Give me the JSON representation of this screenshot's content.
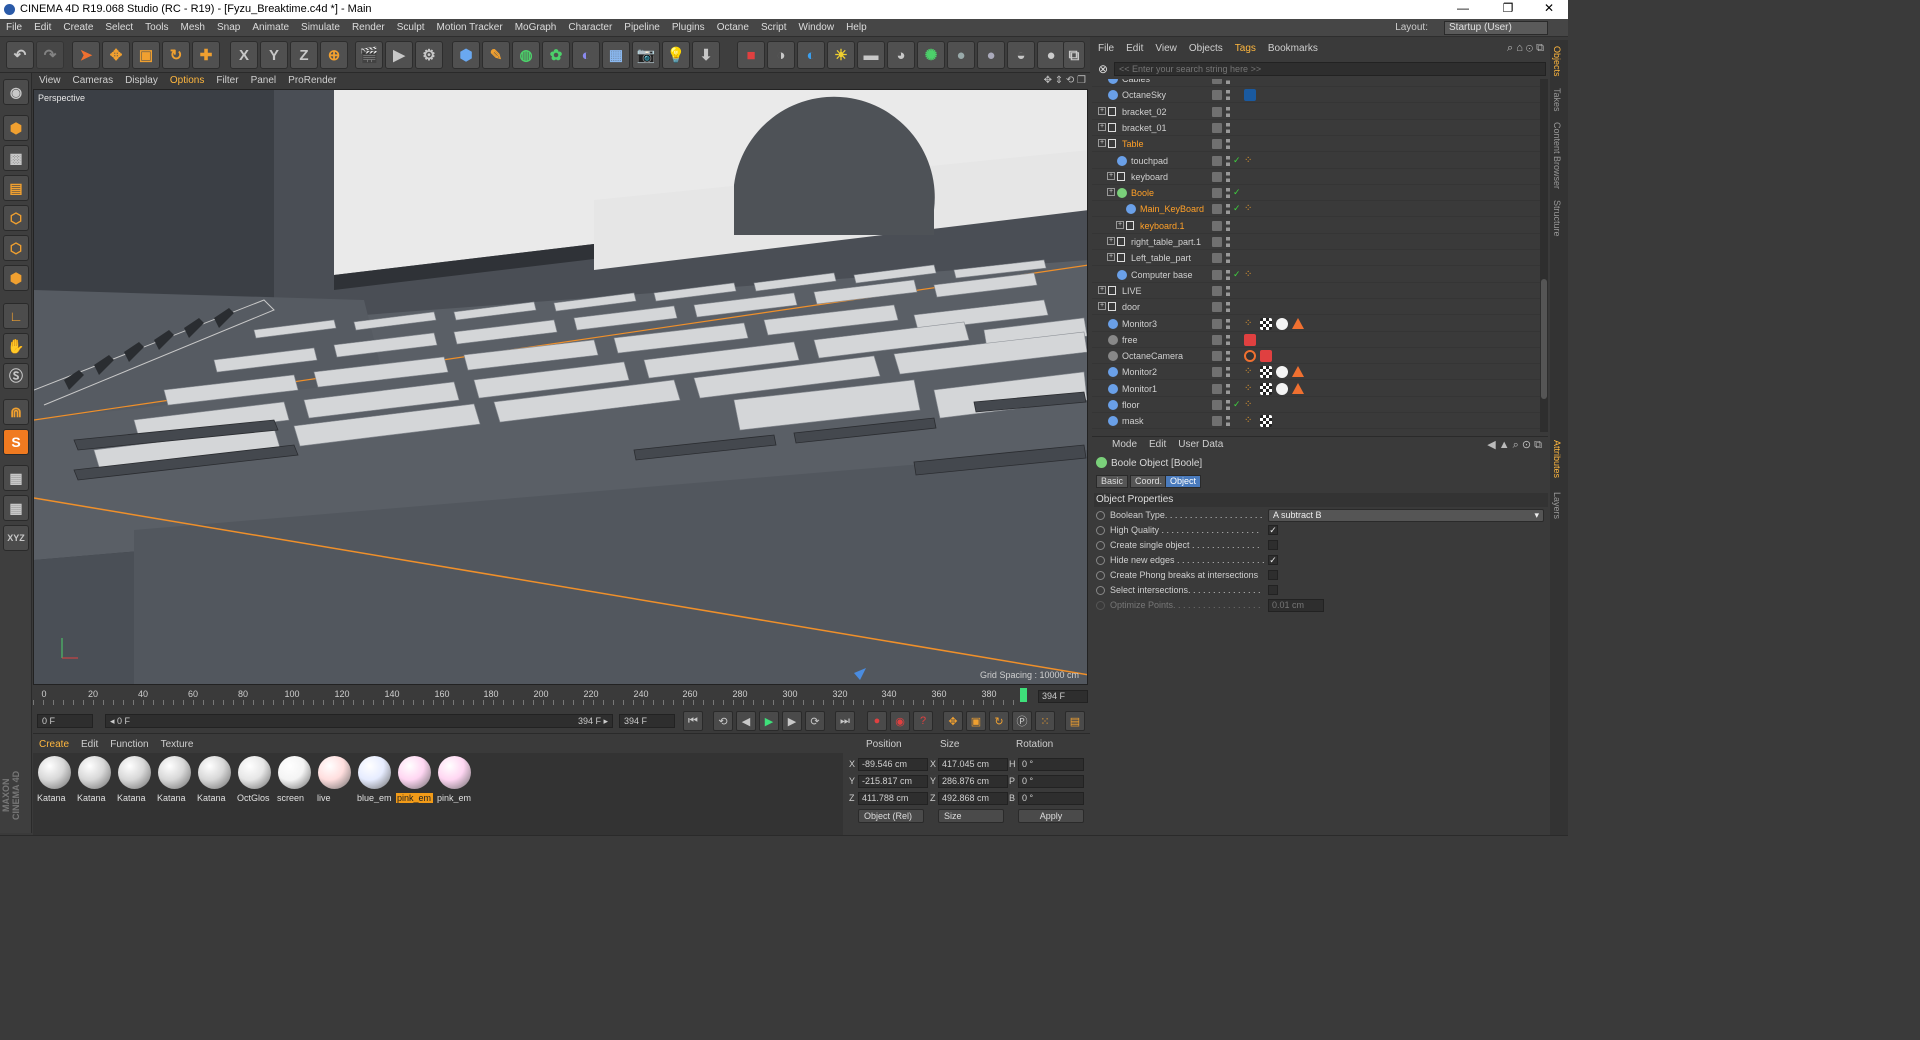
{
  "window": {
    "title": "CINEMA 4D R19.068 Studio (RC - R19) - [Fyzu_Breaktime.c4d *] - Main",
    "controls": [
      "—",
      "❐",
      "✕"
    ]
  },
  "menubar": {
    "items": [
      "File",
      "Edit",
      "Create",
      "Select",
      "Tools",
      "Mesh",
      "Snap",
      "Animate",
      "Simulate",
      "Render",
      "Sculpt",
      "Motion Tracker",
      "MoGraph",
      "Character",
      "Pipeline",
      "Plugins",
      "Octane",
      "Script",
      "Window",
      "Help"
    ],
    "layout_label": "Layout:",
    "layout_value": "Startup (User)"
  },
  "toolbar": {
    "axis_x": "X",
    "axis_y": "Y",
    "axis_z": "Z"
  },
  "viewport": {
    "menu": [
      "View",
      "Cameras",
      "Display",
      "Options",
      "Filter",
      "Panel",
      "ProRender"
    ],
    "active_menu": "Options",
    "label": "Perspective",
    "grid_spacing": "Grid Spacing : 10000 cm"
  },
  "timeline": {
    "ticks": [
      "0",
      "20",
      "40",
      "60",
      "80",
      "100",
      "120",
      "140",
      "160",
      "180",
      "200",
      "220",
      "240",
      "260",
      "280",
      "300",
      "320",
      "340",
      "360",
      "380"
    ],
    "end_frame": "394 F",
    "start_field": "0 F",
    "range_start": "◂ 0 F",
    "range_end": "394 F ▸",
    "max_field": "394 F",
    "current_frame": 394
  },
  "materials": {
    "menu": [
      "Create",
      "Edit",
      "Function",
      "Texture"
    ],
    "active_menu": "Create",
    "items": [
      {
        "name": "Katana",
        "color": "#d8d8d8"
      },
      {
        "name": "Katana",
        "color": "#d8d8d8"
      },
      {
        "name": "Katana",
        "color": "#d8d8d8"
      },
      {
        "name": "Katana",
        "color": "#d8d8d8"
      },
      {
        "name": "Katana",
        "color": "#d8d8d8"
      },
      {
        "name": "OctGlos",
        "color": "#e6e6e6"
      },
      {
        "name": "screen",
        "color": "#f4f4f4"
      },
      {
        "name": "live",
        "color": "#ffdede"
      },
      {
        "name": "blue_em",
        "color": "#e6ecff"
      },
      {
        "name": "pink_em",
        "color": "#ffd6f2",
        "selected": true
      },
      {
        "name": "pink_em",
        "color": "#ffd6f2"
      }
    ]
  },
  "coords": {
    "headers": {
      "position": "Position",
      "size": "Size",
      "rotation": "Rotation"
    },
    "rows": [
      {
        "axis": "X",
        "pos": "-89.546 cm",
        "size_axis": "X",
        "size": "417.045 cm",
        "rot_axis": "H",
        "rot": "0 °"
      },
      {
        "axis": "Y",
        "pos": "-215.817 cm",
        "size_axis": "Y",
        "size": "286.876 cm",
        "rot_axis": "P",
        "rot": "0 °"
      },
      {
        "axis": "Z",
        "pos": "411.788 cm",
        "size_axis": "Z",
        "size": "492.868 cm",
        "rot_axis": "B",
        "rot": "0 °"
      }
    ],
    "mode": "Object (Rel)",
    "size_mode": "Size",
    "apply": "Apply"
  },
  "object_manager": {
    "menu": [
      "File",
      "Edit",
      "View",
      "Objects",
      "Tags",
      "Bookmarks"
    ],
    "active_menu": "Tags",
    "search_placeholder": "<< Enter your search string here >>",
    "rows": [
      {
        "name": "Cables",
        "indent": 0,
        "icon": "#6aa0e8",
        "partial": true
      },
      {
        "name": "OctaneSky",
        "indent": 0,
        "icon": "#6aa0e8",
        "tags": [
          "octane-sky-tag"
        ]
      },
      {
        "name": "bracket_02",
        "indent": 0,
        "icon": "null",
        "expand": true
      },
      {
        "name": "bracket_01",
        "indent": 0,
        "icon": "null",
        "expand": true
      },
      {
        "name": "Table",
        "indent": 0,
        "icon": "null",
        "expand": true,
        "sel": true
      },
      {
        "name": "touchpad",
        "indent": 1,
        "icon": "#6aa0e8",
        "check": true,
        "tags": [
          "phong-tag"
        ]
      },
      {
        "name": "keyboard",
        "indent": 1,
        "icon": "null",
        "expand": true
      },
      {
        "name": "Boole",
        "indent": 1,
        "icon": "#7ad07a",
        "sel": true,
        "expand": true,
        "check": true
      },
      {
        "name": "Main_KeyBoard",
        "indent": 2,
        "icon": "#6aa0e8",
        "sel": true,
        "check": true,
        "tags": [
          "phong-tag"
        ]
      },
      {
        "name": "keyboard.1",
        "indent": 2,
        "icon": "null",
        "sel": true,
        "expand": true
      },
      {
        "name": "right_table_part.1",
        "indent": 1,
        "icon": "null",
        "expand": true
      },
      {
        "name": "Left_table_part",
        "indent": 1,
        "icon": "null",
        "expand": true
      },
      {
        "name": "Computer base",
        "indent": 1,
        "icon": "#6aa0e8",
        "check": true,
        "tags": [
          "phong-tag"
        ]
      },
      {
        "name": "LIVE",
        "indent": 0,
        "icon": "null",
        "expand": true
      },
      {
        "name": "door",
        "indent": 0,
        "icon": "null",
        "expand": true
      },
      {
        "name": "Monitor3",
        "indent": 0,
        "icon": "#6aa0e8",
        "tags": [
          "phong-tag",
          "checker-tag",
          "material-white",
          "warning-tag"
        ]
      },
      {
        "name": "free",
        "indent": 0,
        "icon": "#888",
        "tags": [
          "camera-tag"
        ]
      },
      {
        "name": "OctaneCamera",
        "indent": 0,
        "icon": "#888",
        "tags": [
          "no-tag",
          "camera-tag"
        ]
      },
      {
        "name": "Monitor2",
        "indent": 0,
        "icon": "#6aa0e8",
        "tags": [
          "phong-tag",
          "checker-tag",
          "material-white",
          "warning-tag"
        ]
      },
      {
        "name": "Monitor1",
        "indent": 0,
        "icon": "#6aa0e8",
        "tags": [
          "phong-tag",
          "checker-tag",
          "material-white",
          "warning-tag"
        ]
      },
      {
        "name": "floor",
        "indent": 0,
        "icon": "#6aa0e8",
        "check": true,
        "tags": [
          "phong-tag"
        ]
      },
      {
        "name": "mask",
        "indent": 0,
        "icon": "#6aa0e8",
        "tags": [
          "phong-tag",
          "checker-tag"
        ]
      }
    ]
  },
  "right_tabs": [
    "Objects",
    "Takes",
    "Content Browser",
    "Structure",
    "Attributes",
    "Layers"
  ],
  "attributes": {
    "menu": [
      "Mode",
      "Edit",
      "User Data"
    ],
    "title": "Boole Object [Boole]",
    "tabs": [
      "Basic",
      "Coord.",
      "Object"
    ],
    "active_tab": "Object",
    "section": "Object Properties",
    "props": [
      {
        "label": "Boolean Type. . . . . . . . . . . . . . . . . . . .",
        "type": "select",
        "value": "A subtract B"
      },
      {
        "label": "High Quality . . . . . . . . . . . . . . . . . . . .",
        "type": "check",
        "value": "✓"
      },
      {
        "label": "Create single object . . . . . . . . . . . . . .",
        "type": "check",
        "value": ""
      },
      {
        "label": "Hide new edges . . . . . . . . . . . . . . . . . .",
        "type": "check",
        "value": "✓"
      },
      {
        "label": "Create Phong breaks at intersections",
        "type": "check",
        "value": ""
      },
      {
        "label": "Select intersections. . . . . . . . . . . . . . .",
        "type": "check",
        "value": ""
      },
      {
        "label": "Optimize Points. . . . . . . . . . . . . . . . . .",
        "type": "num",
        "value": "0.01 cm",
        "dim": true
      }
    ]
  },
  "colors": {
    "accent": "#ffb73e",
    "selected_object": "#ffa028",
    "tab_active": "#4a7bbd",
    "playhead": "#3ee07a"
  }
}
